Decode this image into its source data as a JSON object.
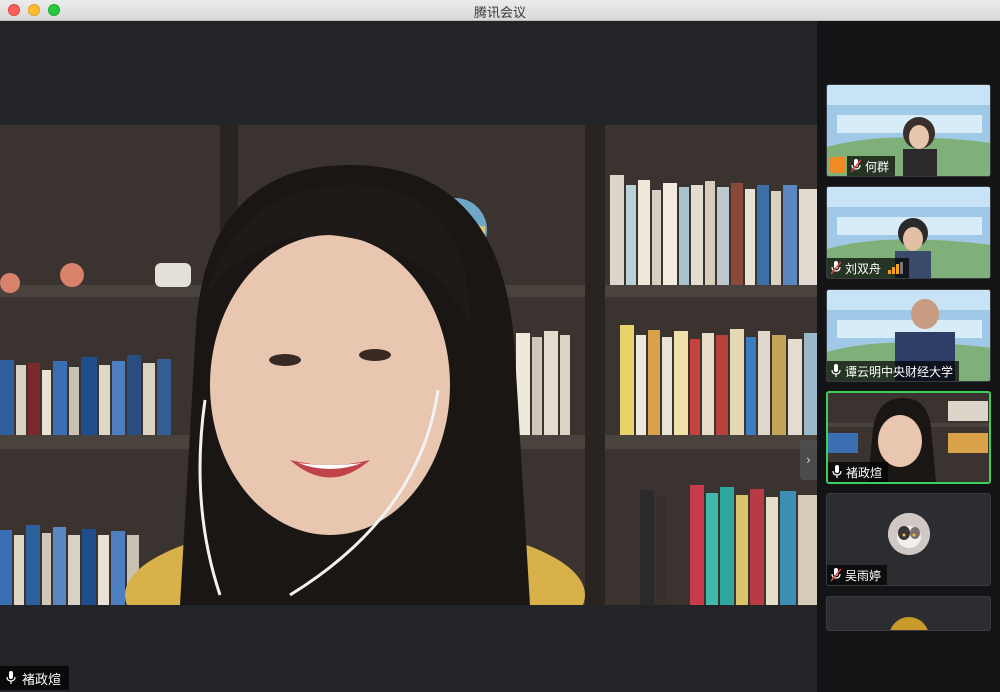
{
  "window": {
    "title": "腾讯会议"
  },
  "main_video": {
    "speaker_name": "褚政煊"
  },
  "participants": [
    {
      "name": "何群",
      "video": true,
      "muted": true,
      "host_icon": "person-icon"
    },
    {
      "name": "刘双舟",
      "video": true,
      "muted": true,
      "speaking": true
    },
    {
      "name": "谭云明中央财经大学",
      "video": true,
      "muted": false
    },
    {
      "name": "褚政煊",
      "video": true,
      "muted": false,
      "active": true
    },
    {
      "name": "吴雨婷",
      "video": false,
      "muted": true
    },
    {
      "name": "",
      "video": false,
      "muted": false
    }
  ],
  "colors": {
    "active_border": "#3ecf5a",
    "speaking_bars": "#f7a21b",
    "mute_red": "#e0443e"
  }
}
